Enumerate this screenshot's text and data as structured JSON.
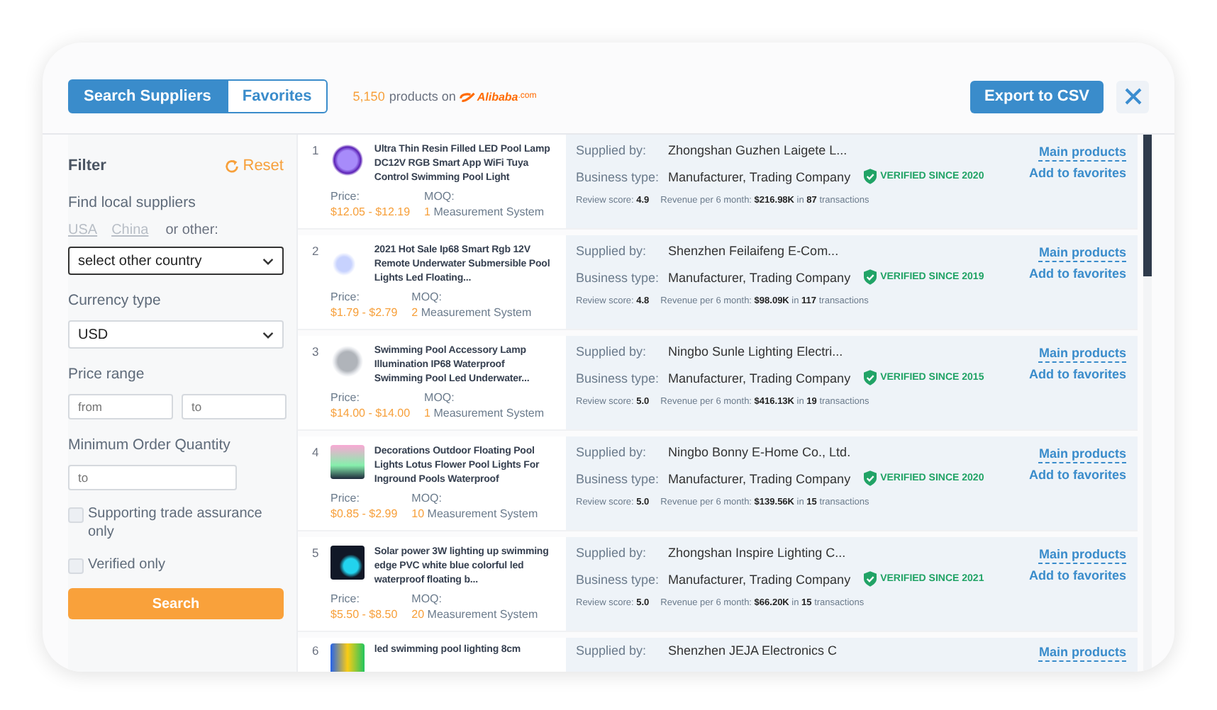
{
  "tabs": [
    {
      "label": "Search Suppliers",
      "selected": true
    },
    {
      "label": "Favorites",
      "selected": false
    }
  ],
  "product_count": "5,150",
  "count_text": "products on",
  "logo": {
    "name": "Alibaba",
    "suffix": ".com"
  },
  "export_button": "Export to CSV",
  "filter": {
    "title": "Filter",
    "reset": "Reset",
    "find_local_label": "Find local suppliers",
    "country_links": [
      {
        "label": "USA"
      },
      {
        "label": "China"
      }
    ],
    "or_other": "or other:",
    "country_select": "select other country",
    "currency_label": "Currency type",
    "currency_select": "USD",
    "price_label": "Price range",
    "price_from": {
      "placeholder": "from"
    },
    "price_to": {
      "placeholder": "to"
    },
    "moq_label": "Minimum Order Quantity",
    "moq_field": {
      "placeholder": "to"
    },
    "checkboxes": [
      {
        "label": "Supporting trade assurance only",
        "checked": false
      },
      {
        "label": "Verified only",
        "checked": false
      }
    ],
    "search_button": "Search"
  },
  "products": [
    {
      "index": "1",
      "title": "Ultra Thin Resin Filled LED Pool Lamp DC12V RGB Smart App WiFi Tuya Control Swimming Pool Light",
      "price_label": "Price:",
      "price": "$12.05 - $12.19",
      "moq_label": "MOQ:",
      "moq_qty": "1",
      "moq_unit": "Measurement System",
      "supplied_label": "Supplied by:",
      "supplier": "Zhongshan Guzhen Laigete L...",
      "business_label": "Business type:",
      "business_type": "Manufacturer, Trading Company",
      "verified": "VERIFIED SINCE 2020",
      "review": "Review score: **4.9**",
      "revenue": "Revenue per 6 month: **$216.98K** in **87** transactions",
      "main_products": "Main products",
      "add_favorites": "Add to favorites"
    },
    {
      "index": "2",
      "title": "2021 Hot Sale Ip68 Smart Rgb 12V Remote Underwater Submersible Pool Lights Led Floating...",
      "price_label": "Price:",
      "price": "$1.79 - $2.79",
      "moq_label": "MOQ:",
      "moq_qty": "2",
      "moq_unit": "Measurement System",
      "supplied_label": "Supplied by:",
      "supplier": "Shenzhen Feilaifeng E-Com...",
      "business_label": "Business type:",
      "business_type": "Manufacturer, Trading Company",
      "verified": "VERIFIED SINCE 2019",
      "review": "Review score: **4.8**",
      "revenue": "Revenue per 6 month: **$98.09K** in **117** transactions",
      "main_products": "Main products",
      "add_favorites": "Add to favorites"
    },
    {
      "index": "3",
      "title": "Swimming Pool Accessory Lamp Illumination IP68 Waterproof Swimming Pool Led Underwater...",
      "price_label": "Price:",
      "price": "$14.00 - $14.00",
      "moq_label": "MOQ:",
      "moq_qty": "1",
      "moq_unit": "Measurement System",
      "supplied_label": "Supplied by:",
      "supplier": "Ningbo Sunle Lighting Electri...",
      "business_label": "Business type:",
      "business_type": "Manufacturer, Trading Company",
      "verified": "VERIFIED SINCE 2015",
      "review": "Review score: **5.0**",
      "revenue": "Revenue per 6 month: **$416.13K** in **19** transactions",
      "main_products": "Main products",
      "add_favorites": "Add to favorites"
    },
    {
      "index": "4",
      "title": "Decorations Outdoor Floating Pool Lights Lotus Flower Pool Lights For Inground Pools Waterproof",
      "price_label": "Price:",
      "price": "$0.85 - $2.99",
      "moq_label": "MOQ:",
      "moq_qty": "10",
      "moq_unit": "Measurement System",
      "supplied_label": "Supplied by:",
      "supplier": "Ningbo Bonny E-Home Co., Ltd.",
      "business_label": "Business type:",
      "business_type": "Manufacturer, Trading Company",
      "verified": "VERIFIED SINCE 2020",
      "review": "Review score: **5.0**",
      "revenue": "Revenue per 6 month: **$139.56K** in **15** transactions",
      "main_products": "Main products",
      "add_favorites": "Add to favorites"
    },
    {
      "index": "5",
      "title": "Solar power 3W lighting up swimming edge PVC white blue colorful led waterproof floating b...",
      "price_label": "Price:",
      "price": "$5.50 - $8.50",
      "moq_label": "MOQ:",
      "moq_qty": "20",
      "moq_unit": "Measurement System",
      "supplied_label": "Supplied by:",
      "supplier": "Zhongshan Inspire Lighting C...",
      "business_label": "Business type:",
      "business_type": "Manufacturer, Trading Company",
      "verified": "VERIFIED SINCE 2021",
      "review": "Review score: **5.0**",
      "revenue": "Revenue per 6 month: **$66.20K** in **15** transactions",
      "main_products": "Main products",
      "add_favorites": "Add to favorites"
    },
    {
      "index": "6",
      "title": "led swimming pool lighting 8cm",
      "supplied_label": "Supplied by:",
      "supplier": "Shenzhen JEJA Electronics C",
      "main_products": "Main products"
    }
  ]
}
